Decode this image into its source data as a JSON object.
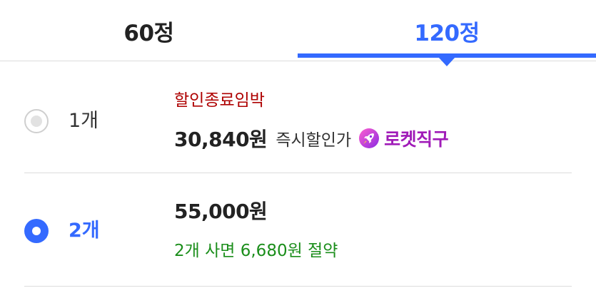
{
  "tabs": [
    {
      "label": "60정",
      "selected": false
    },
    {
      "label": "120정",
      "selected": true
    }
  ],
  "accent_color": "#346aff",
  "options": [
    {
      "quantity": "1개",
      "selected": false,
      "urgent_label": "할인종료임박",
      "price": "30,840원",
      "price_note": "즉시할인가",
      "badge": {
        "icon": "rocket-icon",
        "label": "로켓직구"
      }
    },
    {
      "quantity": "2개",
      "selected": true,
      "price": "55,000원",
      "savings": "2개 사면 6,680원 절약"
    }
  ]
}
